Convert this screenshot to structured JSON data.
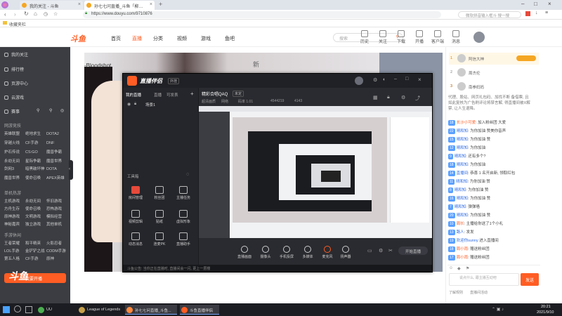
{
  "browser": {
    "tabs": [
      {
        "label": "我的关注 - 斗鱼",
        "active": false
      },
      {
        "label": "孙七七问直播_斗鱼「柳…",
        "active": true
      }
    ],
    "url": "https://www.douyu.com/9710876",
    "search_placeholder": "微软拼音输入框斗 搜一搜",
    "bookmark": "收藏夹栏"
  },
  "header": {
    "logo": "斗鱼",
    "nav": [
      "首页",
      "直播",
      "分类",
      "视频",
      "游戏",
      "鱼吧"
    ],
    "search_placeholder": "搜索",
    "icons": [
      "历史",
      "关注",
      "下载",
      "开播",
      "客户端",
      "消息"
    ]
  },
  "sidebar": {
    "items": [
      "我的关注",
      "排行榜",
      "页游中心",
      "云游戏"
    ],
    "row_icons": [
      "赛事",
      "",
      "",
      ""
    ],
    "sections": [
      {
        "title": "网游竞技",
        "entries": [
          "英雄联盟",
          "绝地求生",
          "DOTA2",
          "穿越火线",
          "CF手游",
          "DNF",
          "炉石传说",
          "CS:GO",
          "魔兽争霸",
          "永劫无间",
          "星际争霸",
          "魔兽世界",
          "剑网3",
          "暗黑破坏神",
          "DOTA",
          "魔兽世界",
          "使命召唤",
          "APEX英雄"
        ]
      },
      {
        "title": "单机热游",
        "entries": [
          "主机游戏",
          "永劫无间",
          "怀旧游戏",
          "方舟生存",
          "使命召唤",
          "恐怖游戏",
          "原神游戏",
          "文明游戏",
          "模拟经营",
          "神秘嘉宾",
          "独立游戏",
          "其他单机"
        ]
      },
      {
        "title": "手游休闲",
        "entries": [
          "王者荣耀",
          "和平精英",
          "火影忍者",
          "LOL手游",
          "金铲铲之战",
          "CODM手游",
          "第五人格",
          "CF手游",
          "原神"
        ]
      }
    ],
    "promo": "我要开播",
    "promo2": "斗鱼"
  },
  "stream": {
    "text_left": "-Bloodshot",
    "text_right": "新"
  },
  "companion": {
    "title": "直播伴侣",
    "badge": "外挂",
    "tabs": [
      "我的直播",
      "直播",
      "可发表"
    ],
    "scene": "场景1",
    "room_title": "精彩合唱QAQ",
    "status_tag": "未定",
    "sub_tags": [
      "超清画质",
      "网络",
      "码率"
    ],
    "sub_values": [
      "码率 1.01",
      "4544219",
      "4143"
    ],
    "tools_header": "工具箱",
    "tools": [
      "房间管理",
      "粉丝团",
      "主播任务",
      "视频剪辑",
      "贴纸",
      "虚拟形象",
      "动态消息",
      "连麦PK",
      "直播助手",
      "更多"
    ],
    "bottom_buttons": [
      "直播画面",
      "摄像头",
      "手机投屏",
      "多媒体",
      "麦克风",
      "扬声器"
    ],
    "start_button": "开始直播",
    "notice": "斗鱼公告: 当你正在直播时, 直播间会一闪, 更上一层楼"
  },
  "chat": {
    "rank": [
      {
        "no": "1",
        "name": "阿信大神"
      },
      {
        "no": "2",
        "name": "周杰伦"
      },
      {
        "no": "3",
        "name": "南拳妈妈"
      }
    ],
    "notice_lines": [
      "代理、股站、网页礼包码、加找不断 备借票, 且",
      "如此复核为广告刷评论将禁言解, 得直播间被X解",
      "禁, 让人生退降。"
    ],
    "messages": [
      {
        "lv": "18",
        "nick": "长沙小可爱",
        "text": "加入粉丝团 大爱"
      },
      {
        "lv": "22",
        "nick": "晴和知",
        "text": "为你加油 赞美你音声"
      },
      {
        "lv": "15",
        "nick": "晴和知",
        "text": "为你加油 赞"
      },
      {
        "lv": "12",
        "nick": "晴和知",
        "text": "为你加油"
      },
      {
        "lv": "9",
        "nick": "晴和知",
        "text": "还有多个?"
      },
      {
        "lv": "18",
        "nick": "晴和知",
        "text": "为你加油"
      },
      {
        "lv": "14",
        "nick": "直播间",
        "text": "恭喜 1 名开启新, 领取红包"
      },
      {
        "lv": "11",
        "nick": "晴和知",
        "text": "为你加油 赞"
      },
      {
        "lv": "8",
        "nick": "晴和知",
        "text": "为你加油 赞"
      },
      {
        "lv": "16",
        "nick": "晴和知",
        "text": "为你加油 赞"
      },
      {
        "lv": "7",
        "nick": "晴和知",
        "text": "弹弹墙"
      },
      {
        "lv": "20",
        "nick": "晴和知",
        "text": "为你加油 赞"
      },
      {
        "lv": "10",
        "nick": "周长",
        "text": "主播给你送了1个小礼"
      },
      {
        "lv": "13",
        "nick": "路人",
        "text": "发发"
      },
      {
        "lv": "19",
        "nick": "欢迎你sunny",
        "text": "进入直播间"
      },
      {
        "lv": "18",
        "nick": "周小雨",
        "text": "赠送粉丝团"
      },
      {
        "lv": "17",
        "nick": "周小雨",
        "text": "赠送粉丝团"
      }
    ],
    "input_placeholder": "说点什么, 跟主播互动吧",
    "send": "发送",
    "footer_left": "了解规则",
    "footer_right": "直播间活动"
  },
  "taskbar": {
    "apps": [
      "UU",
      "League of Legends",
      "孙七七问直播_斗鱼...",
      "斗鱼直播伴侣"
    ],
    "time": "20:21",
    "date": "2021/9/10"
  },
  "colors": {
    "accent": "#ff5d23",
    "sidebar": "#3b3d42",
    "companion": "#1b1c20"
  }
}
